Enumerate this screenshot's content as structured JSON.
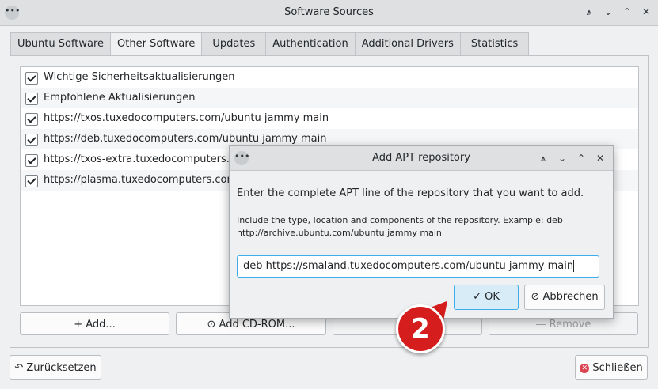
{
  "window": {
    "title": "Software Sources",
    "menu_icon": "dots-icon"
  },
  "tabs": [
    {
      "label": "Ubuntu Software"
    },
    {
      "label": "Other Software"
    },
    {
      "label": "Updates"
    },
    {
      "label": "Authentication"
    },
    {
      "label": "Additional Drivers"
    },
    {
      "label": "Statistics"
    }
  ],
  "active_tab": "Other Software",
  "sources": [
    {
      "label": "Wichtige Sicherheitsaktualisierungen",
      "checked": true
    },
    {
      "label": "Empfohlene Aktualisierungen",
      "checked": true
    },
    {
      "label": "https://txos.tuxedocomputers.com/ubuntu jammy main",
      "checked": true
    },
    {
      "label": "https://deb.tuxedocomputers.com/ubuntu jammy main",
      "checked": true
    },
    {
      "label": "https://txos-extra.tuxedocomputers.co",
      "checked": true
    },
    {
      "label": "https://plasma.tuxedocomputers.com",
      "checked": true
    }
  ],
  "buttons": {
    "add": "+ Add...",
    "add_cdrom": "⊙ Add CD-ROM...",
    "edit": "✎",
    "remove": "— Remove",
    "reset": "↶ Zurücksetzen",
    "close": "Schließen"
  },
  "dialog": {
    "title": "Add APT repository",
    "prompt": "Enter the complete APT line of the repository that you want to add.",
    "hint": "Include the type, location and components of the repository. Example: deb http://archive.ubuntu.com/ubuntu jammy main",
    "input_value": "deb https://smaland.tuxedocomputers.com/ubuntu jammy main",
    "ok": "OK",
    "cancel": "Abbrechen"
  },
  "callout": {
    "number": "2",
    "color": "#d51d1d"
  },
  "colors": {
    "accent": "#3daee9",
    "close_icon": "#da4453"
  }
}
